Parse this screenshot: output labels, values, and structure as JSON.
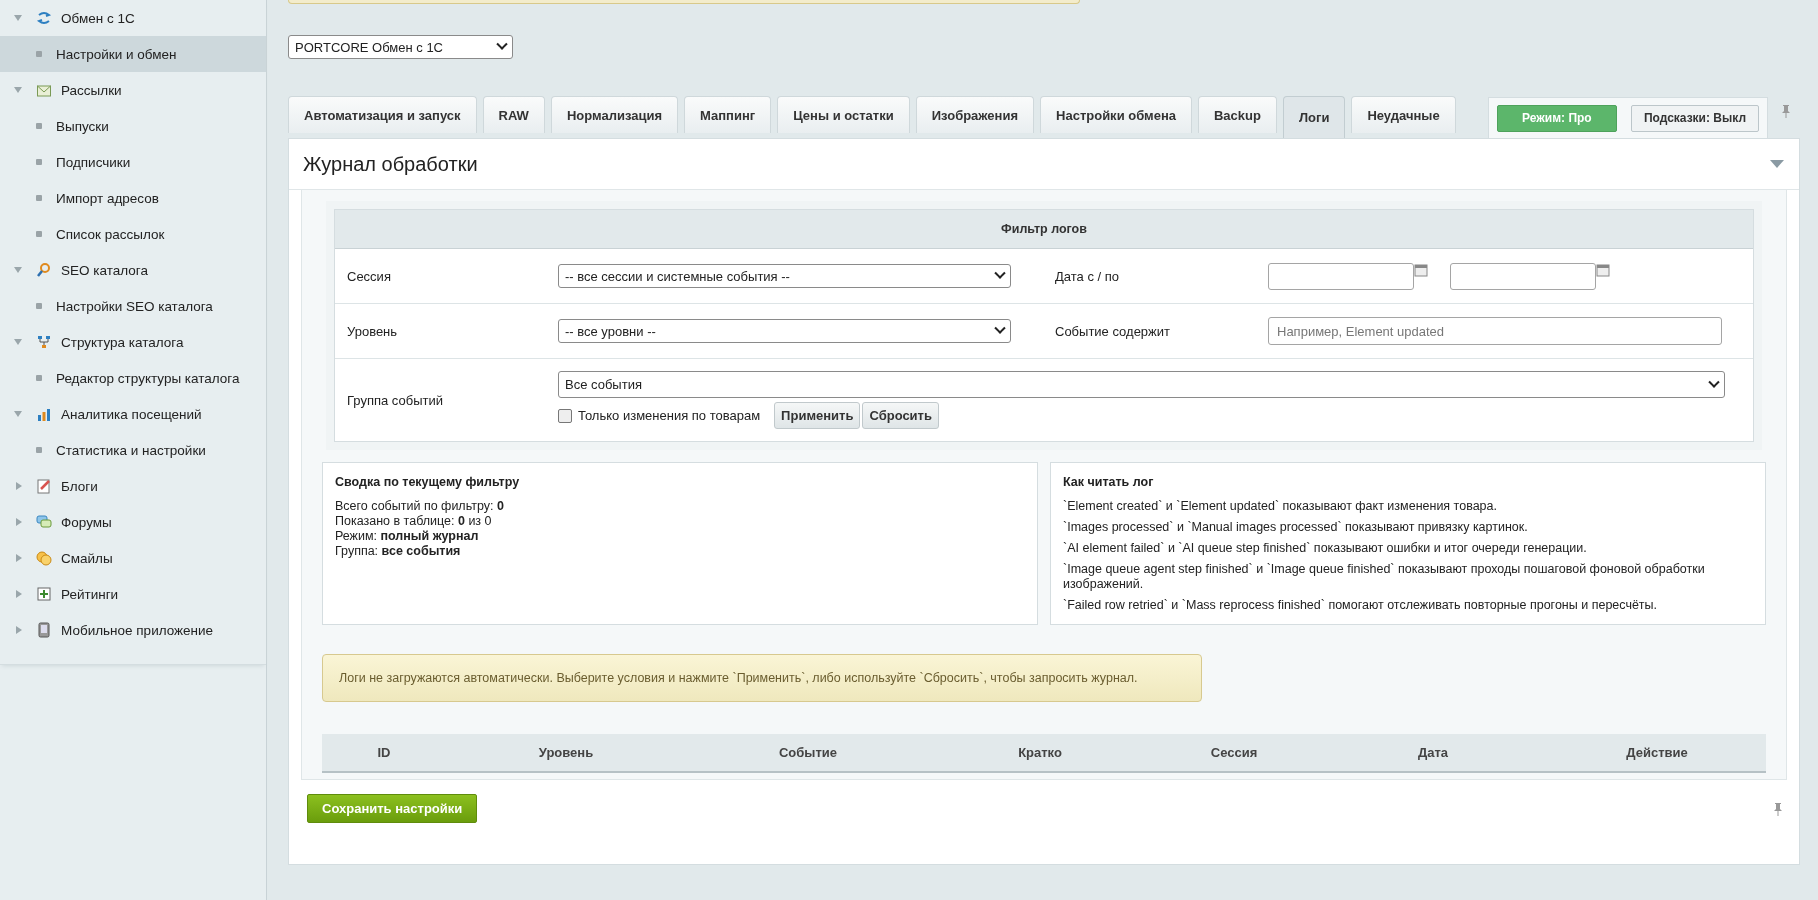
{
  "sidebar": {
    "items": [
      {
        "label": "Обмен с 1С",
        "expanded": true,
        "children": [
          {
            "label": "Настройки и обмен",
            "selected": true
          }
        ]
      },
      {
        "label": "Рассылки",
        "expanded": true,
        "children": [
          {
            "label": "Выпуски",
            "selected": false
          },
          {
            "label": "Подписчики",
            "selected": false
          },
          {
            "label": "Импорт адресов",
            "selected": false
          },
          {
            "label": "Список рассылок",
            "selected": false
          }
        ]
      },
      {
        "label": "SEO каталога",
        "expanded": true,
        "children": [
          {
            "label": "Настройки SEO каталога",
            "selected": false
          }
        ]
      },
      {
        "label": "Структура каталога",
        "expanded": true,
        "children": [
          {
            "label": "Редактор структуры каталога",
            "selected": false
          }
        ]
      },
      {
        "label": "Аналитика посещений",
        "expanded": true,
        "children": [
          {
            "label": "Статистика и настройки",
            "selected": false
          }
        ]
      },
      {
        "label": "Блоги",
        "expanded": false
      },
      {
        "label": "Форумы",
        "expanded": false
      },
      {
        "label": "Смайлы",
        "expanded": false
      },
      {
        "label": "Рейтинги",
        "expanded": false
      },
      {
        "label": "Мобильное приложение",
        "expanded": false
      }
    ]
  },
  "module_select": {
    "value": "PORTCORE Обмен с 1С"
  },
  "tabs": [
    {
      "label": "Автоматизация и запуск",
      "selected": false
    },
    {
      "label": "RAW",
      "selected": false
    },
    {
      "label": "Нормализация",
      "selected": false
    },
    {
      "label": "Маппинг",
      "selected": false
    },
    {
      "label": "Цены и остатки",
      "selected": false
    },
    {
      "label": "Изображения",
      "selected": false
    },
    {
      "label": "Настройки обмена",
      "selected": false
    },
    {
      "label": "Backup",
      "selected": false
    },
    {
      "label": "Логи",
      "selected": true
    },
    {
      "label": "Неудачные",
      "selected": false
    }
  ],
  "toggles": [
    {
      "label": "Режим: Про",
      "on": true
    },
    {
      "label": "Подсказки: Выкл",
      "on": false
    }
  ],
  "panel": {
    "title": "Журнал обработки",
    "filter": {
      "title": "Фильтр логов",
      "session_label": "Сессия",
      "session_value": "-- все сессии и системные события --",
      "date_label": "Дата с / по",
      "level_label": "Уровень",
      "level_value": "-- все уровни --",
      "contains_label": "Событие содержит",
      "contains_placeholder": "Например, Element updated",
      "group_label": "Группа событий",
      "group_value": "Все события",
      "only_products": {
        "label": "Только изменения по товарам",
        "checked": false
      },
      "buttons": [
        "Применить",
        "Сбросить"
      ]
    },
    "summary": {
      "title": "Сводка по текущему фильтру",
      "lines": [
        "Всего событий по фильтру: **0**",
        "Показано в таблице: **0** из 0",
        "Режим: **полный журнал**",
        "Группа: **все события**"
      ]
    },
    "help": {
      "title": "Как читать лог",
      "lines": [
        "`Element created` и `Element updated` показывают факт изменения товара.",
        "`Images processed` и `Manual images processed` показывают привязку картинок.",
        "`AI element failed` и `AI queue step finished` показывают ошибки и итог очереди генерации.",
        "`Image queue agent step finished` и `Image queue finished` показывают проходы пошаговой фоновой обработки изображений.",
        "`Failed row retried` и `Mass reprocess finished` помогают отслеживать повторные прогоны и пересчёты."
      ]
    },
    "notice": "Логи не загружаются автоматически. Выберите условия и нажмите `Применить`, либо используйте `Сбросить`, чтобы запросить журнал.",
    "table": {
      "columns": [
        "ID",
        "Уровень",
        "Событие",
        "Кратко",
        "Сессия",
        "Дата",
        "Действие"
      ]
    },
    "save_button": "Сохранить настройки"
  }
}
